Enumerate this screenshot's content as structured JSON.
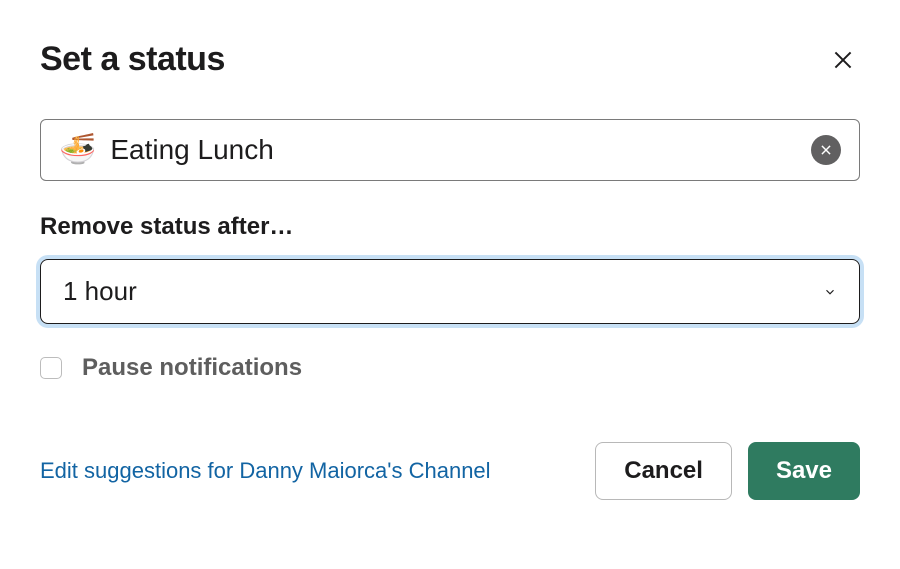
{
  "header": {
    "title": "Set a status"
  },
  "status": {
    "emoji": "🍜",
    "value": "Eating Lunch"
  },
  "duration": {
    "label": "Remove status after…",
    "value": "1 hour"
  },
  "pause": {
    "label": "Pause notifications",
    "checked": false
  },
  "footer": {
    "edit_link": "Edit suggestions for Danny Maiorca's Channel",
    "cancel": "Cancel",
    "save": "Save"
  }
}
